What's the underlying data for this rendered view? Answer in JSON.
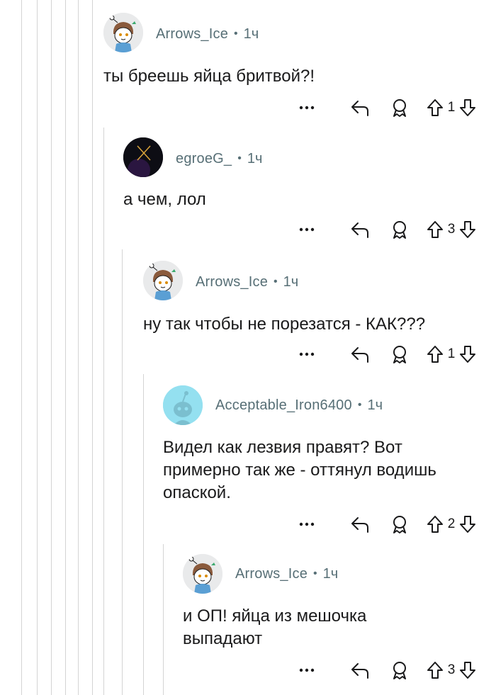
{
  "comments": [
    {
      "username": "Arrows_Ice",
      "dot": "•",
      "time": "1ч",
      "body": "ты бреешь яйца бритвой?!",
      "score": "1",
      "avatar_icon": "snoo-avatar-icon"
    },
    {
      "username": "egroeG_",
      "dot": "•",
      "time": "1ч",
      "body": "а чем, лол",
      "score": "3",
      "avatar_icon": "dark-avatar-icon"
    },
    {
      "username": "Arrows_Ice",
      "dot": "•",
      "time": "1ч",
      "body": "ну так чтобы не порезатся - КАК???",
      "score": "1",
      "avatar_icon": "snoo-avatar-icon"
    },
    {
      "username": "Acceptable_Iron6400",
      "dot": "•",
      "time": "1ч",
      "body": "Видел как лезвия правят? Вот\nпримерно так же - оттянул водишь\nопаской.",
      "score": "2",
      "avatar_icon": "default-snoo-icon"
    },
    {
      "username": "Arrows_Ice",
      "dot": "•",
      "time": "1ч",
      "body": "и ОП! яйца из мешочка\nвыпадают",
      "score": "3",
      "avatar_icon": "snoo-avatar-icon"
    }
  ],
  "colors": {
    "thread_line": "#d4d4d4",
    "meta_text": "#576f76",
    "icon": "#1a1a1b",
    "default_avatar_bg": "#94e0f0"
  }
}
